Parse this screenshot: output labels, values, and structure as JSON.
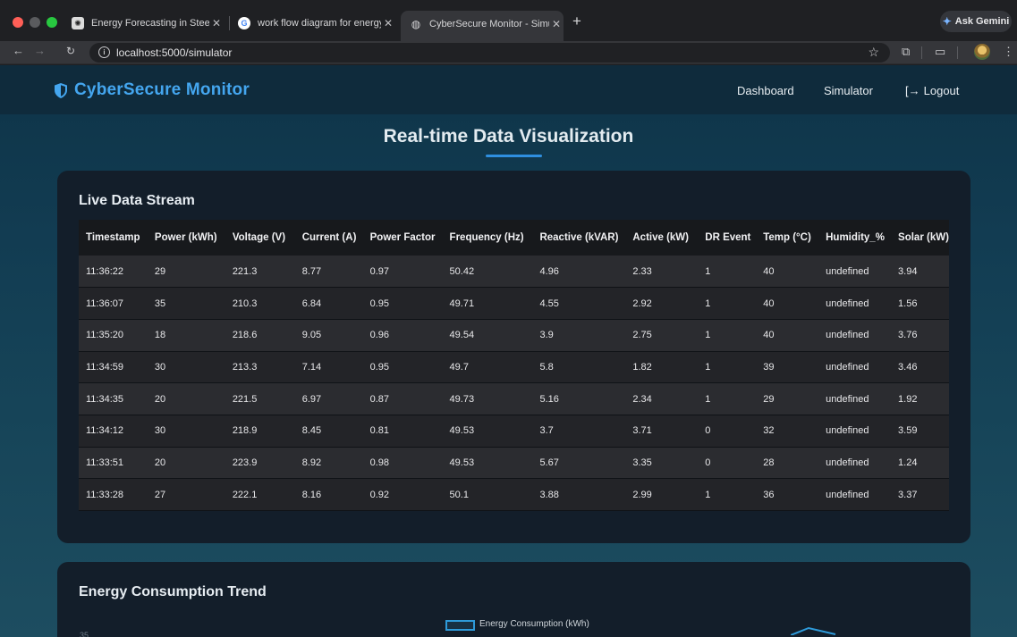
{
  "browser": {
    "tabs": [
      {
        "title": "Energy Forecasting in Steel",
        "icon": "openai-icon"
      },
      {
        "title": "work flow diagram for energy",
        "icon": "google-icon"
      },
      {
        "title": "CyberSecure Monitor - Simul",
        "icon": "globe-icon"
      }
    ],
    "url": "localhost:5000/simulator",
    "gemini_label": "Ask Gemini"
  },
  "app": {
    "brand": "CyberSecure Monitor",
    "brand_color": "#44a6ef",
    "nav": {
      "dashboard": "Dashboard",
      "simulator": "Simulator",
      "logout": "Logout"
    }
  },
  "page": {
    "title": "Real-time Data Visualization",
    "accent": "#2f8fe0"
  },
  "live_stream": {
    "title": "Live Data Stream",
    "columns": [
      "Timestamp",
      "Power (kWh)",
      "Voltage (V)",
      "Current (A)",
      "Power Factor",
      "Frequency (Hz)",
      "Reactive (kVAR)",
      "Active (kW)",
      "DR Event",
      "Temp (°C)",
      "Humidity_%",
      "Solar (kW)"
    ],
    "rows": [
      [
        "11:36:22",
        "29",
        "221.3",
        "8.77",
        "0.97",
        "50.42",
        "4.96",
        "2.33",
        "1",
        "40",
        "undefined",
        "3.94"
      ],
      [
        "11:36:07",
        "35",
        "210.3",
        "6.84",
        "0.95",
        "49.71",
        "4.55",
        "2.92",
        "1",
        "40",
        "undefined",
        "1.56"
      ],
      [
        "11:35:20",
        "18",
        "218.6",
        "9.05",
        "0.96",
        "49.54",
        "3.9",
        "2.75",
        "1",
        "40",
        "undefined",
        "3.76"
      ],
      [
        "11:34:59",
        "30",
        "213.3",
        "7.14",
        "0.95",
        "49.7",
        "5.8",
        "1.82",
        "1",
        "39",
        "undefined",
        "3.46"
      ],
      [
        "11:34:35",
        "20",
        "221.5",
        "6.97",
        "0.87",
        "49.73",
        "5.16",
        "2.34",
        "1",
        "29",
        "undefined",
        "1.92"
      ],
      [
        "11:34:12",
        "30",
        "218.9",
        "8.45",
        "0.81",
        "49.53",
        "3.7",
        "3.71",
        "0",
        "32",
        "undefined",
        "3.59"
      ],
      [
        "11:33:51",
        "20",
        "223.9",
        "8.92",
        "0.98",
        "49.53",
        "5.67",
        "3.35",
        "0",
        "28",
        "undefined",
        "1.24"
      ],
      [
        "11:33:28",
        "27",
        "222.1",
        "8.16",
        "0.92",
        "50.1",
        "3.88",
        "2.99",
        "1",
        "36",
        "undefined",
        "3.37"
      ]
    ]
  },
  "trend": {
    "title": "Energy Consumption Trend",
    "legend": "Energy Consumption (kWh)",
    "y_top_tick": "35",
    "line_color": "#2e9ad9"
  }
}
